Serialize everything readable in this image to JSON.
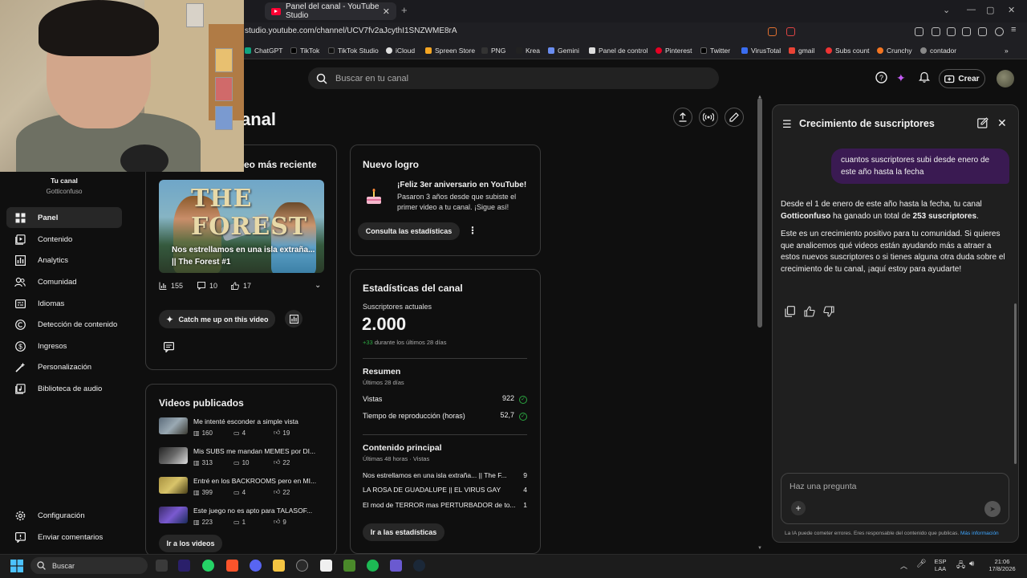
{
  "browser": {
    "tab_title": "Panel del canal - YouTube Studio",
    "url": "studio.youtube.com/channel/UCV7fv2aJcythI1SNZWME8rA",
    "bookmarks": [
      "ChatGPT",
      "TikTok",
      "TikTok Studio",
      "iCloud",
      "Spreen Store",
      "PNG",
      "Krea",
      "Gemini",
      "Panel de control",
      "Pinterest",
      "Twitter",
      "VirusTotal",
      "gmail",
      "Subs count",
      "Crunchy",
      "contador"
    ]
  },
  "header": {
    "search_placeholder": "Buscar en tu canal",
    "create_label": "Crear"
  },
  "sidebar": {
    "channel_title": "Tu canal",
    "channel_name": "Gotticonfuso",
    "items": [
      {
        "label": "Panel",
        "icon": "dashboard-icon"
      },
      {
        "label": "Contenido",
        "icon": "content-icon"
      },
      {
        "label": "Analytics",
        "icon": "analytics-icon"
      },
      {
        "label": "Comunidad",
        "icon": "community-icon"
      },
      {
        "label": "Idiomas",
        "icon": "languages-icon"
      },
      {
        "label": "Detección de contenido",
        "icon": "copyright-icon"
      },
      {
        "label": "Ingresos",
        "icon": "dollar-icon"
      },
      {
        "label": "Personalización",
        "icon": "customization-icon"
      },
      {
        "label": "Biblioteca de audio",
        "icon": "audio-library-icon"
      }
    ],
    "bottom": [
      {
        "label": "Configuración",
        "icon": "gear-icon"
      },
      {
        "label": "Enviar comentarios",
        "icon": "feedback-icon"
      }
    ]
  },
  "main": {
    "page_title": "anal",
    "latest_video": {
      "title_partial": "eo más reciente",
      "thumb_text": "THE FOREST",
      "caption": "Nos estrellamos en una isla extraña... || The Forest #1",
      "views": "155",
      "comments": "10",
      "likes": "17",
      "catch_up_label": "Catch me up on this video"
    },
    "published": {
      "title": "Videos publicados",
      "rows": [
        {
          "title": "Me intenté esconder a simple vista",
          "views": "160",
          "comments": "4",
          "likes": "19"
        },
        {
          "title": "Mis SUBS me mandan MEMES por DI...",
          "views": "313",
          "comments": "10",
          "likes": "22"
        },
        {
          "title": "Entré en los BACKROOMS pero en MI...",
          "views": "399",
          "comments": "4",
          "likes": "22"
        },
        {
          "title": "Este juego no es apto para TALASOF...",
          "views": "223",
          "comments": "1",
          "likes": "9"
        }
      ],
      "go_videos_label": "Ir a los videos"
    },
    "achievement": {
      "title": "Nuevo logro",
      "headline": "¡Feliz 3er aniversario en YouTube!",
      "body": "Pasaron 3 años desde que subiste el primer video a tu canal. ¡Sigue así!",
      "button": "Consulta las estadísticas"
    },
    "stats": {
      "title": "Estadísticas del canal",
      "subs_label": "Suscriptores actuales",
      "subs_value": "2.000",
      "subs_delta": "+33",
      "subs_delta_text": "durante los últimos 28 días",
      "summary_title": "Resumen",
      "summary_sub": "Últimos 28 días",
      "views_label": "Vistas",
      "views_value": "922",
      "watch_label": "Tiempo de reproducción (horas)",
      "watch_value": "52,7",
      "top_title": "Contenido principal",
      "top_sub": "Últimas 48 horas · Vistas",
      "top_rows": [
        {
          "title": "Nos estrellamos en una isla extraña... || The F...",
          "value": "9"
        },
        {
          "title": "LA ROSA DE GUADALUPE || EL VIRUS GAY",
          "value": "4"
        },
        {
          "title": "El mod de TERROR mas PERTURBADOR de to...",
          "value": "1"
        }
      ],
      "button": "Ir a las estadísticas"
    }
  },
  "ai_panel": {
    "title": "Crecimiento de suscriptores",
    "user_message": "cuantos suscriptores subi desde enero de este año hasta la fecha",
    "answer_p1_a": "Desde el 1 de enero de este año hasta la fecha, tu canal ",
    "answer_p1_channel": "Gotticonfuso",
    "answer_p1_b": " ha ganado un total de ",
    "answer_p1_count": "253 suscriptores",
    "answer_p1_c": ".",
    "answer_p2": "Este es un crecimiento positivo para tu comunidad. Si quieres que analicemos qué videos están ayudando más a atraer a estos nuevos suscriptores o si tienes alguna otra duda sobre el crecimiento de tu canal, ¡aquí estoy para ayudarte!",
    "input_placeholder": "Haz una pregunta",
    "disclaimer": "La IA puede cometer errores. Eres responsable del contenido que publicas.",
    "disclaimer_link": "Más información"
  },
  "taskbar": {
    "search_label": "Buscar",
    "lang_top": "ESP",
    "lang_bottom": "LAA",
    "time": "21:06",
    "date": "17/8/2026"
  },
  "colors": {
    "accent_purple": "#3a1a52",
    "success_green": "#2ba640",
    "brand_red": "#ff0033",
    "link_blue": "#3ea6ff"
  }
}
